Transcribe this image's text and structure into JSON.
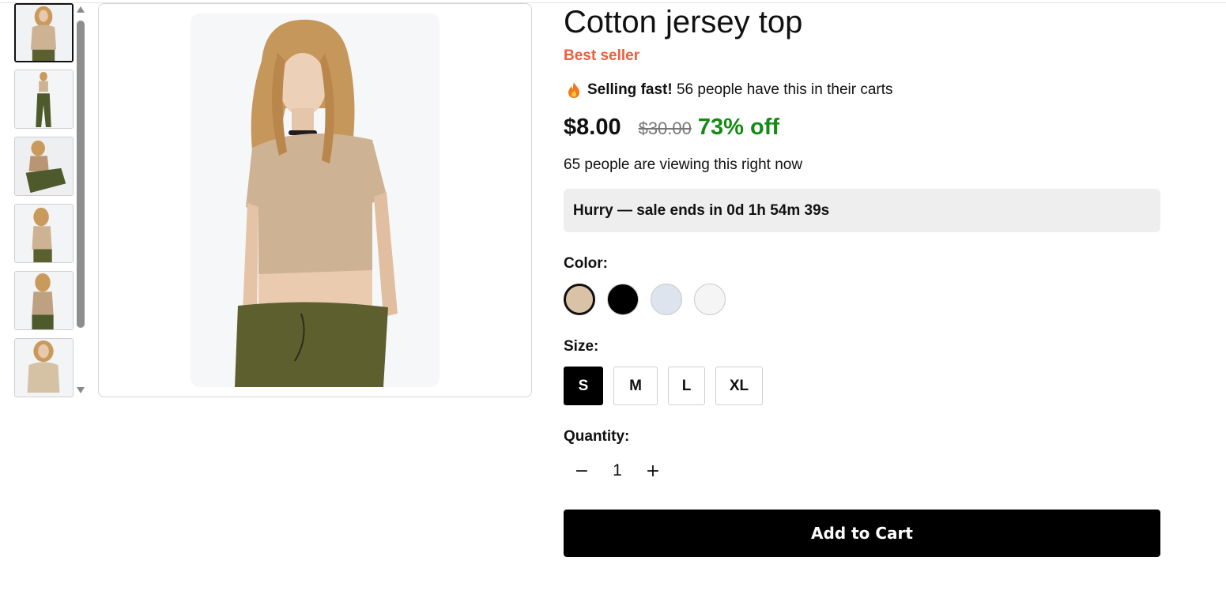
{
  "product": {
    "title": "Cotton jersey top",
    "badge": "Best seller",
    "urgency": {
      "icon": "flame-icon",
      "strong": "Selling fast!",
      "text": "56 people have this in their carts"
    },
    "price": "$8.00",
    "original_price": "$30.00",
    "discount": "73% off",
    "viewing": "65 people are viewing this right now",
    "sale_banner": "Hurry — sale ends in 0d 1h 54m 39s"
  },
  "gallery": {
    "thumbnails": [
      "front view",
      "full length",
      "seated pose",
      "side view",
      "back view",
      "close-up"
    ],
    "selected_index": 0
  },
  "color": {
    "label": "Color:",
    "options": [
      "#d9c2a6",
      "#000000",
      "#dde4ee",
      "#f5f5f5"
    ],
    "selected_index": 0
  },
  "size": {
    "label": "Size:",
    "options": [
      "S",
      "M",
      "L",
      "XL"
    ],
    "selected": "S"
  },
  "quantity": {
    "label": "Quantity:",
    "decrement": "−",
    "value": "1",
    "increment": "+"
  },
  "cart": {
    "button_label": "Add to Cart"
  },
  "colors": {
    "badge": "#ec5f3e",
    "discount": "#138a13",
    "primary_button": "#000000"
  }
}
